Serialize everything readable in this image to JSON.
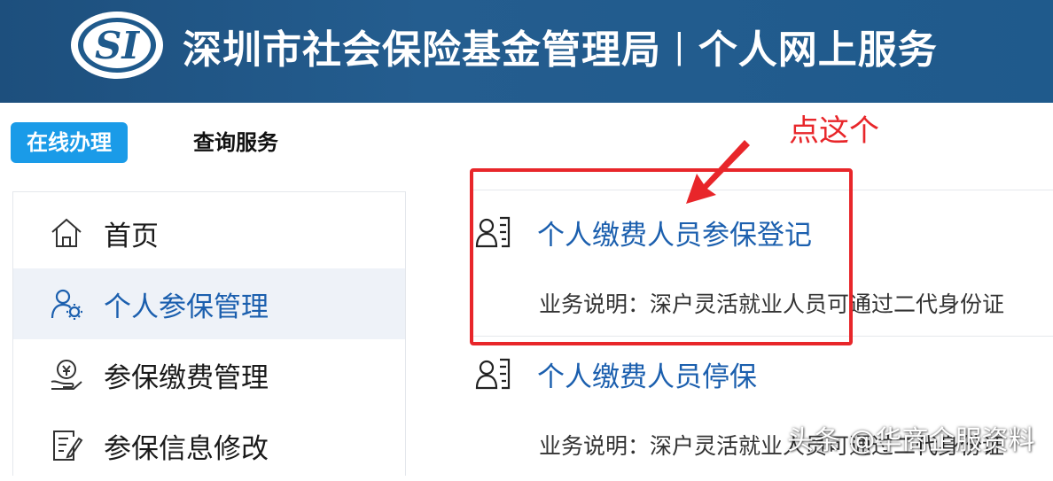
{
  "header": {
    "logo_text": "SI",
    "org_name": "深圳市社会保险基金管理局",
    "separator": "|",
    "portal_name": "个人网上服务"
  },
  "tabs": [
    {
      "label": "在线办理",
      "active": true
    },
    {
      "label": "查询服务",
      "active": false
    }
  ],
  "sidebar": {
    "items": [
      {
        "label": "首页",
        "icon": "home-icon",
        "active": false
      },
      {
        "label": "个人参保管理",
        "icon": "user-gear-icon",
        "active": true
      },
      {
        "label": "参保缴费管理",
        "icon": "payment-hand-icon",
        "active": false
      },
      {
        "label": "参保信息修改",
        "icon": "edit-document-icon",
        "active": false
      }
    ]
  },
  "services": [
    {
      "title": "个人缴费人员参保登记",
      "description": "业务说明：深户灵活就业人员可通过二代身份证",
      "icon": "person-list-icon"
    },
    {
      "title": "个人缴费人员停保",
      "description": "业务说明：深户灵活就业人员可通过二代身份证",
      "icon": "person-list-icon"
    }
  ],
  "annotation": {
    "text": "点这个",
    "color": "#e8262a"
  },
  "watermark": "头条 @华商企服资料",
  "colors": {
    "header_bg": "#245d8f",
    "tab_active_bg": "#1a9be8",
    "link_blue": "#1b5fae",
    "annotation_red": "#e8262a"
  }
}
